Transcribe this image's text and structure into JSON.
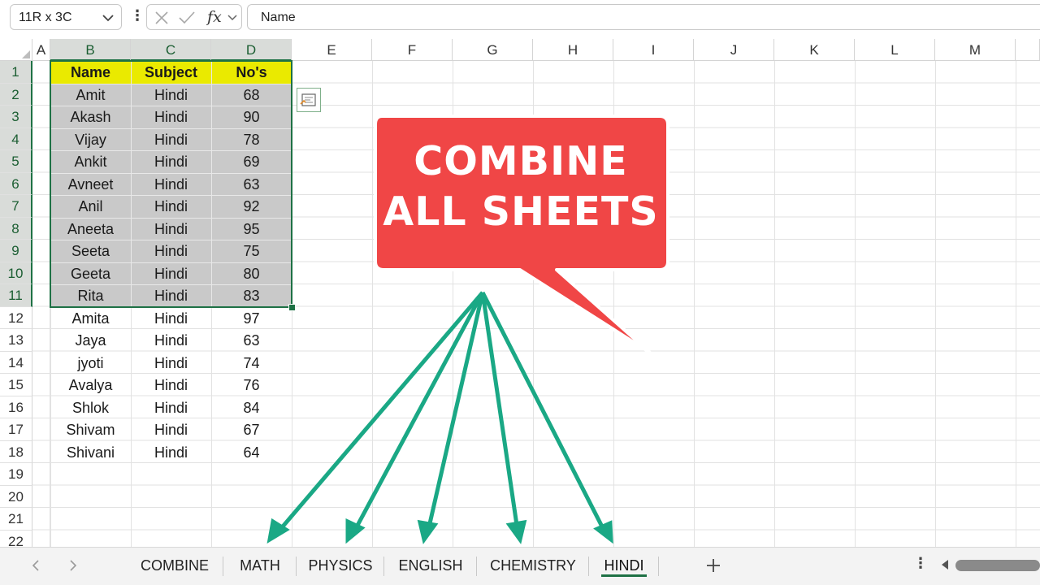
{
  "formula_bar": {
    "name_box": "11R x 3C",
    "fx_label": "fx",
    "formula_value": "Name"
  },
  "columns": [
    "A",
    "B",
    "C",
    "D",
    "E",
    "F",
    "G",
    "H",
    "I",
    "J",
    "K",
    "L",
    "M"
  ],
  "rows": [
    "1",
    "2",
    "3",
    "4",
    "5",
    "6",
    "7",
    "8",
    "9",
    "10",
    "11",
    "12",
    "13",
    "14",
    "15",
    "16",
    "17",
    "18",
    "19",
    "20",
    "21",
    "22"
  ],
  "table": {
    "headers": [
      "Name",
      "Subject",
      "No's"
    ],
    "rows": [
      [
        "Amit",
        "Hindi",
        "68"
      ],
      [
        "Akash",
        "Hindi",
        "90"
      ],
      [
        "Vijay",
        "Hindi",
        "78"
      ],
      [
        "Ankit",
        "Hindi",
        "69"
      ],
      [
        "Avneet",
        "Hindi",
        "63"
      ],
      [
        "Anil",
        "Hindi",
        "92"
      ],
      [
        "Aneeta",
        "Hindi",
        "95"
      ],
      [
        "Seeta",
        "Hindi",
        "75"
      ],
      [
        "Geeta",
        "Hindi",
        "80"
      ],
      [
        "Rita",
        "Hindi",
        "83"
      ],
      [
        "Amita",
        "Hindi",
        "97"
      ],
      [
        "Jaya",
        "Hindi",
        "63"
      ],
      [
        "jyoti",
        "Hindi",
        "74"
      ],
      [
        "Avalya",
        "Hindi",
        "76"
      ],
      [
        "Shlok",
        "Hindi",
        "84"
      ],
      [
        "Shivam",
        "Hindi",
        "67"
      ],
      [
        "Shivani",
        "Hindi",
        "64"
      ]
    ]
  },
  "selection": {
    "range_label": "11R x 3C"
  },
  "callout": {
    "line1": "COMBINE",
    "line2": "ALL SHEETS"
  },
  "sheet_tabs": [
    "COMBINE",
    "MATH",
    "PHYSICS",
    "ENGLISH",
    "CHEMISTRY",
    "HINDI"
  ],
  "active_tab": "HINDI",
  "colors": {
    "accent_green": "#1e7145",
    "header_yellow": "#eaea00",
    "callout_red": "#f04646",
    "arrow_teal": "#1aa885",
    "selection_gray": "#c9c9c9"
  },
  "icons": [
    "chevron-down-icon",
    "more-options-icon",
    "cancel-icon",
    "enter-icon",
    "function-icon",
    "quick-analysis-icon",
    "tab-prev-icon",
    "tab-next-icon",
    "add-sheet-icon",
    "scroll-left-icon"
  ]
}
